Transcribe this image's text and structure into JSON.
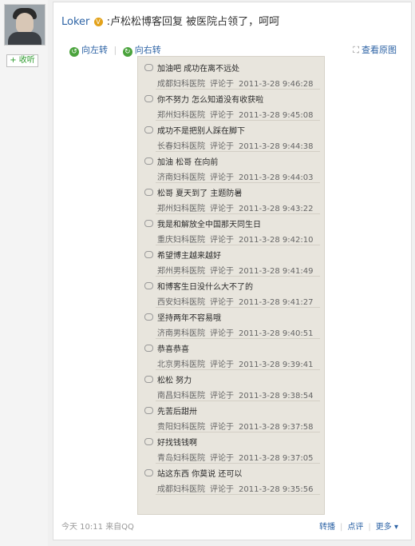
{
  "left": {
    "follow_label": "+ 收听"
  },
  "post": {
    "author": "Loker",
    "verified_icon": "v-badge-icon",
    "text": ":卢松松博客回复 被医院占领了，呵呵",
    "rotate_left": "向左转",
    "rotate_right": "向右转",
    "view_original": "查看原图",
    "time": "今天 10:11",
    "source": "来自QQ",
    "repost": "转播",
    "comment": "点评",
    "more": "更多"
  },
  "comments": [
    {
      "text": "加油吧  成功在离不远处",
      "author": "成都妇科医院",
      "verb": "评论于",
      "time": "2011-3-28 9:46:28"
    },
    {
      "text": "你不努力  怎么知道没有收获啦",
      "author": "郑州妇科医院",
      "verb": "评论于",
      "time": "2011-3-28 9:45:08"
    },
    {
      "text": "成功不是把别人踩在脚下",
      "author": "长春妇科医院",
      "verb": "评论于",
      "time": "2011-3-28 9:44:38"
    },
    {
      "text": "加油  松哥  在向前",
      "author": "济南妇科医院",
      "verb": "评论于",
      "time": "2011-3-28 9:44:03"
    },
    {
      "text": "松哥  夏天到了  主题防暑",
      "author": "郑州妇科医院",
      "verb": "评论于",
      "time": "2011-3-28 9:43:22"
    },
    {
      "text": "我是和解放全中国那天同生日",
      "author": "重庆妇科医院",
      "verb": "评论于",
      "time": "2011-3-28 9:42:10"
    },
    {
      "text": "希望博主越来越好",
      "author": "郑州男科医院",
      "verb": "评论于",
      "time": "2011-3-28 9:41:49"
    },
    {
      "text": "和博客生日没什么大不了的",
      "author": "西安妇科医院",
      "verb": "评论于",
      "time": "2011-3-28 9:41:27"
    },
    {
      "text": "坚持两年不容易哦",
      "author": "济南男科医院",
      "verb": "评论于",
      "time": "2011-3-28 9:40:51"
    },
    {
      "text": "恭喜恭喜",
      "author": "北京男科医院",
      "verb": "评论于",
      "time": "2011-3-28 9:39:41"
    },
    {
      "text": "松松  努力",
      "author": "南昌妇科医院",
      "verb": "评论于",
      "time": "2011-3-28 9:38:54"
    },
    {
      "text": "先苦后甜卅",
      "author": "贵阳妇科医院",
      "verb": "评论于",
      "time": "2011-3-28 9:37:58"
    },
    {
      "text": "好找钱钱啊",
      "author": "青岛妇科医院",
      "verb": "评论于",
      "time": "2011-3-28 9:37:05"
    },
    {
      "text": "站这东西  你莫说  还可以",
      "author": "成都妇科医院",
      "verb": "评论于",
      "time": "2011-3-28 9:35:56"
    }
  ]
}
